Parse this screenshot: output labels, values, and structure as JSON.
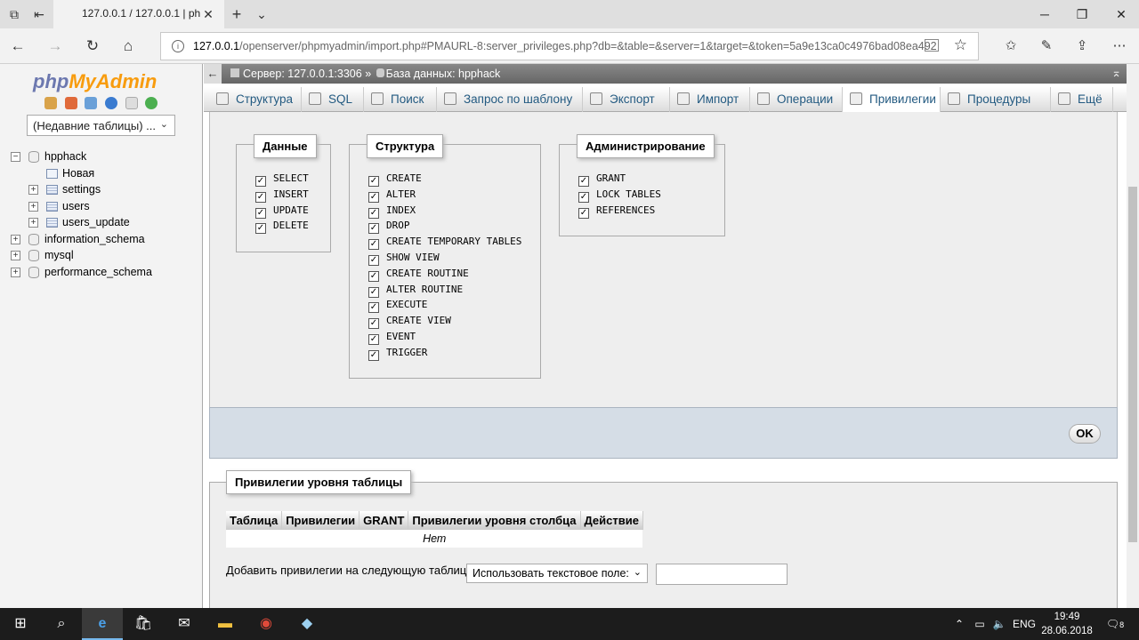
{
  "browser": {
    "tab_title": "127.0.0.1 / 127.0.0.1 | ph",
    "url_host": "127.0.0.1",
    "url_rest": "/openserver/phpmyadmin/import.php#PMAURL-8:server_privileges.php?db=&table=&server=1&target=&token=5a9e13ca0c4976bad08ea492"
  },
  "sidebar": {
    "logo_php": "php",
    "logo_myadmin": "MyAdmin",
    "recent_tables": "(Недавние таблицы) ...",
    "tree": [
      {
        "label": "hpphack",
        "level": 0,
        "expander": "−",
        "icon": "db"
      },
      {
        "label": "Новая",
        "level": 1,
        "expander": "",
        "icon": "new"
      },
      {
        "label": "settings",
        "level": 1,
        "expander": "+",
        "icon": "table"
      },
      {
        "label": "users",
        "level": 1,
        "expander": "+",
        "icon": "table"
      },
      {
        "label": "users_update",
        "level": 1,
        "expander": "+",
        "icon": "table"
      },
      {
        "label": "information_schema",
        "level": 0,
        "expander": "+",
        "icon": "db"
      },
      {
        "label": "mysql",
        "level": 0,
        "expander": "+",
        "icon": "db"
      },
      {
        "label": "performance_schema",
        "level": 0,
        "expander": "+",
        "icon": "db"
      }
    ]
  },
  "breadcrumb": {
    "server": "Сервер: 127.0.0.1:3306",
    "sep": "»",
    "database": "База данных: hpphack"
  },
  "menu_tabs": [
    {
      "label": "Структура",
      "icon": "structure-icon"
    },
    {
      "label": "SQL",
      "icon": "sql-icon"
    },
    {
      "label": "Поиск",
      "icon": "search-icon"
    },
    {
      "label": "Запрос по шаблону",
      "icon": "query-icon"
    },
    {
      "label": "Экспорт",
      "icon": "export-icon"
    },
    {
      "label": "Импорт",
      "icon": "import-icon"
    },
    {
      "label": "Операции",
      "icon": "operations-icon"
    },
    {
      "label": "Привилегии",
      "icon": "privileges-icon",
      "active": true
    },
    {
      "label": "Процедуры",
      "icon": "routines-icon"
    },
    {
      "label": "Ещё",
      "icon": "more-icon"
    }
  ],
  "privileges": {
    "data": {
      "legend": "Данные",
      "items": [
        "SELECT",
        "INSERT",
        "UPDATE",
        "DELETE"
      ]
    },
    "structure": {
      "legend": "Структура",
      "items": [
        "CREATE",
        "ALTER",
        "INDEX",
        "DROP",
        "CREATE TEMPORARY TABLES",
        "SHOW VIEW",
        "CREATE ROUTINE",
        "ALTER ROUTINE",
        "EXECUTE",
        "CREATE VIEW",
        "EVENT",
        "TRIGGER"
      ]
    },
    "admin": {
      "legend": "Администрирование",
      "items": [
        "GRANT",
        "LOCK TABLES",
        "REFERENCES"
      ]
    },
    "checked_mark": "☑"
  },
  "ok_button": "OK",
  "table_privileges": {
    "legend": "Привилегии уровня таблицы",
    "columns": [
      "Таблица",
      "Привилегии",
      "GRANT",
      "Привилегии уровня столбца",
      "Действие"
    ],
    "empty_text": "Нет",
    "add_label": "Добавить привилегии на следующую таблицу:",
    "add_select": "Использовать текстовое поле:",
    "add_input": ""
  },
  "taskbar": {
    "lang": "ENG",
    "time": "19:49",
    "date": "28.06.2018",
    "notif_count": "8"
  }
}
